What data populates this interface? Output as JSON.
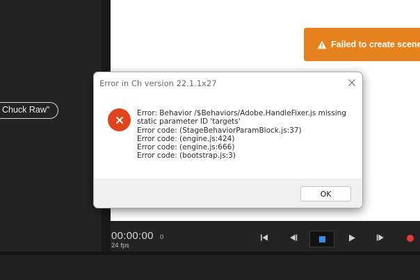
{
  "left_panel": {
    "puppet_label": "Chuck Raw\""
  },
  "stage": {
    "toast": {
      "icon": "warning-icon",
      "text": "Failed to create scene",
      "color": "#e5821e"
    }
  },
  "transport": {
    "timecode": "00:00:00",
    "frame": "0",
    "fps": "24 fps",
    "buttons": [
      "go-to-start-icon",
      "step-back-icon",
      "stop-icon",
      "play-icon",
      "step-forward-icon",
      "record-icon"
    ],
    "stop_color": "#3b8be8",
    "record_color": "#e23b33"
  },
  "dialog": {
    "title": "Error in Ch version 22.1.1x27",
    "icon": "error-icon",
    "lines": [
      "Error: Behavior /$Behaviors/Adobe.HandleFixer.js missing",
      "static parameter ID 'targets'",
      "Error code: (StageBehaviorParamBlock.js:37)",
      "Error code: (engine.js:424)",
      "Error code: (engine.js:666)",
      "Error code: (bootstrap.js:3)"
    ],
    "ok_label": "OK",
    "icon_color": "#e0441c"
  }
}
